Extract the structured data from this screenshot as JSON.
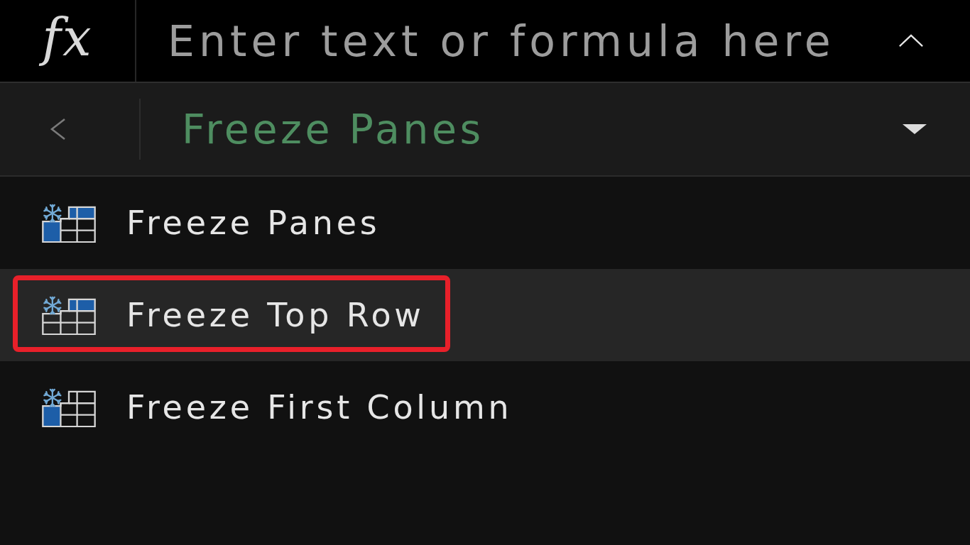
{
  "formula_bar": {
    "function_label": "fx",
    "placeholder": "Enter text or formula here"
  },
  "submenu": {
    "title": "Freeze Panes"
  },
  "items": [
    {
      "label": "Freeze Panes",
      "kind": "panes",
      "selected": false,
      "highlighted": false
    },
    {
      "label": "Freeze Top Row",
      "kind": "top-row",
      "selected": true,
      "highlighted": true
    },
    {
      "label": "Freeze First Column",
      "kind": "first-column",
      "selected": false,
      "highlighted": false
    }
  ]
}
